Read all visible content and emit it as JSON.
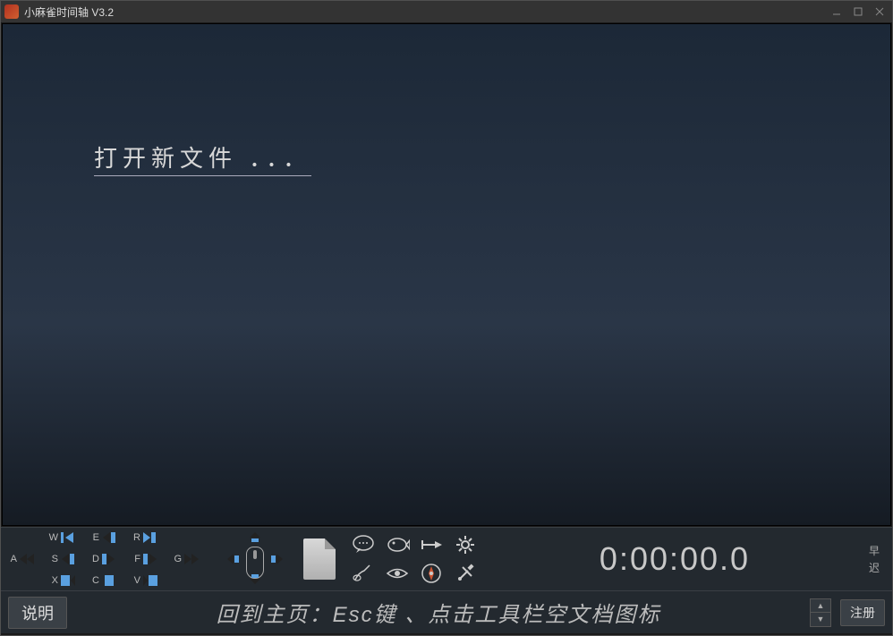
{
  "title": "小麻雀时间轴 V3.2",
  "open_new_file_label": "打开新文件 ．．．",
  "timecode": "0:00:00.0",
  "early_label": "早",
  "late_label": "迟",
  "help_button": "说明",
  "register_button": "注册",
  "status_text": "回到主页：Esc键 、点击工具栏空文档图标",
  "keys": {
    "W": "W",
    "E": "E",
    "R": "R",
    "A": "A",
    "S": "S",
    "D": "D",
    "F": "F",
    "G": "G",
    "X": "X",
    "C": "C",
    "V": "V"
  }
}
